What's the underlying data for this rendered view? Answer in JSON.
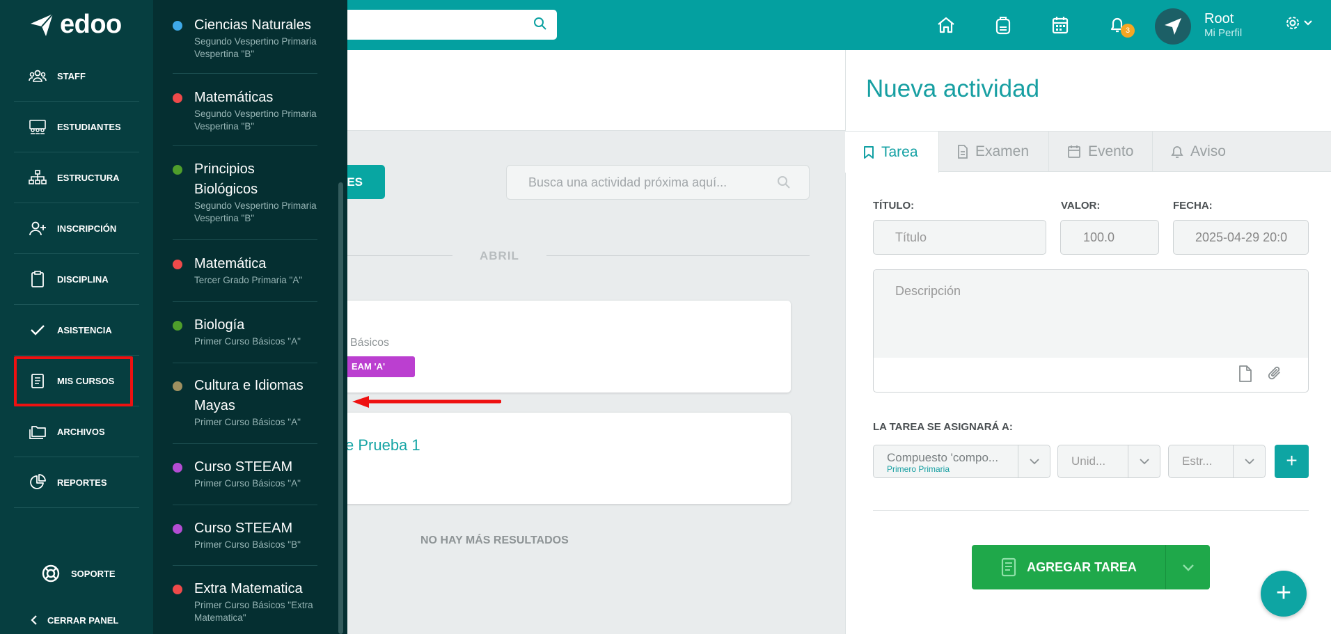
{
  "brand": {
    "logo_text": "edoo"
  },
  "sidebar": {
    "items": [
      {
        "label": "STAFF",
        "icon": "staff-icon"
      },
      {
        "label": "ESTUDIANTES",
        "icon": "students-icon"
      },
      {
        "label": "ESTRUCTURA",
        "icon": "structure-icon"
      },
      {
        "label": "INSCRIPCIÓN",
        "icon": "enrollment-icon"
      },
      {
        "label": "DISCIPLINA",
        "icon": "clipboard-icon"
      },
      {
        "label": "ASISTENCIA",
        "icon": "check-icon"
      },
      {
        "label": "MIS CURSOS",
        "icon": "book-icon"
      },
      {
        "label": "ARCHIVOS",
        "icon": "folders-icon"
      },
      {
        "label": "REPORTES",
        "icon": "pie-chart-icon"
      }
    ],
    "support_label": "SOPORTE",
    "close_label": "CERRAR PANEL"
  },
  "courses": [
    {
      "name": "Ciencias Naturales",
      "sub": "Segundo Vespertino Primaria Vespertina \"B\"",
      "color": "#3fa9e8"
    },
    {
      "name": "Matemáticas",
      "sub": "Segundo Vespertino Primaria Vespertina \"B\"",
      "color": "#ef4a4a"
    },
    {
      "name": "Principios Biológicos",
      "sub": "Segundo Vespertino Primaria Vespertina \"B\"",
      "color": "#4f9e2b"
    },
    {
      "name": "Matemática",
      "sub": "Tercer Grado Primaria \"A\"",
      "color": "#ef4a4a"
    },
    {
      "name": "Biología",
      "sub": "Primer Curso Básicos \"A\"",
      "color": "#4f9e2b"
    },
    {
      "name": "Cultura e Idiomas Mayas",
      "sub": "Primer Curso Básicos \"A\"",
      "color": "#a09060"
    },
    {
      "name": "Curso STEEAM",
      "sub": "Primer Curso Básicos \"A\"",
      "color": "#b44dd3"
    },
    {
      "name": "Curso STEEAM",
      "sub": "Primer Curso Básicos \"B\"",
      "color": "#b44dd3"
    },
    {
      "name": "Extra Matematica",
      "sub": "Primer Curso Básicos \"Extra Matematica\"",
      "color": "#ef4a4a"
    }
  ],
  "topbar": {
    "user_name": "Root",
    "user_sub": "Mi Perfil",
    "notification_count": "3"
  },
  "main": {
    "button_partial": "ES",
    "search_placeholder": "Busca una actividad próxima aquí...",
    "month": "ABRIL",
    "card1_sub": "Básicos",
    "card1_tag": "EAM 'A'",
    "card2_title": "e Prueba 1",
    "no_more": "NO HAY MÁS RESULTADOS"
  },
  "panel": {
    "title": "Nueva actividad",
    "tabs": [
      {
        "label": "Tarea",
        "icon": "bookmark-icon"
      },
      {
        "label": "Examen",
        "icon": "document-icon"
      },
      {
        "label": "Evento",
        "icon": "calendar-icon"
      },
      {
        "label": "Aviso",
        "icon": "bell-icon"
      }
    ],
    "labels": {
      "title": "TÍTULO:",
      "value": "VALOR:",
      "date": "FECHA:"
    },
    "title_placeholder": "Título",
    "value": "100.0",
    "date": "2025-04-29 20:0",
    "description_placeholder": "Descripción",
    "assign_label": "LA TAREA SE ASIGNARÁ A:",
    "select1": {
      "text": "Compuesto 'compo...",
      "sub": "Primero Primaria"
    },
    "select2": "Unid...",
    "select3": "Estr...",
    "add_button": "AGREGAR TAREA"
  },
  "colors": {
    "brand": "#04a0a0",
    "sidebar": "#063e40",
    "add": "#1fa84a",
    "highlight": "#ee1111"
  }
}
